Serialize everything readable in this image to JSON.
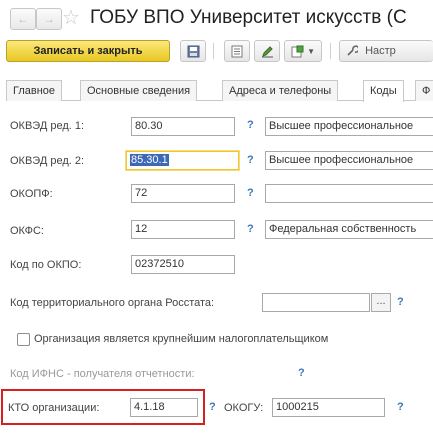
{
  "window": {
    "title": "ГОБУ ВПО Университет искусств (С"
  },
  "toolbar": {
    "save_close_label": "Записать и закрыть",
    "settings_label": "Настр"
  },
  "tabs": [
    {
      "label": "Главное"
    },
    {
      "label": "Основные сведения"
    },
    {
      "label": "Адреса и телефоны"
    },
    {
      "label": "Коды"
    },
    {
      "label": "Ф"
    }
  ],
  "form": {
    "okved1": {
      "label": "ОКВЭД ред. 1:",
      "value": "80.30",
      "description": "Высшее профессиональное"
    },
    "okved2": {
      "label": "ОКВЭД ред. 2:",
      "value": "85.30.1",
      "description": "Высшее профессиональное"
    },
    "okopf": {
      "label": "ОКОПФ:",
      "value": "72",
      "description": ""
    },
    "okfs": {
      "label": "ОКФС:",
      "value": "12",
      "description": "Федеральная собственность"
    },
    "okpo": {
      "label": "Код по ОКПО:",
      "value": "02372510"
    },
    "rosstat": {
      "label": "Код территориального органа Росстата:",
      "value": ""
    },
    "taxpayer_checkbox": {
      "label": "Организация является крупнейшим налогоплательщиком",
      "checked": false
    },
    "ifns": {
      "label": "Код ИФНС - получателя отчетности:"
    },
    "kto": {
      "label": "КТО организации:",
      "value": "4.1.18"
    },
    "okogu": {
      "label": "ОКОГУ:",
      "value": "1000215"
    },
    "help_mark": "?"
  },
  "colors": {
    "primary_button": "#e9c823",
    "highlight_box": "#d62020",
    "help": "#3c78b4"
  }
}
